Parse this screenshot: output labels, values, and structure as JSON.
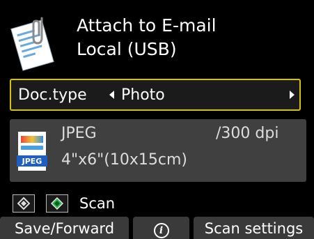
{
  "header": {
    "icon": "document-with-paperclip-icon",
    "title": "Attach to E-mail",
    "subtitle": "Local (USB)"
  },
  "doc_type": {
    "label": "Doc.type",
    "value": "Photo",
    "highlight_color": "#d9c300"
  },
  "scan_info": {
    "icon": "jpeg-file-icon",
    "icon_label": "JPEG",
    "format": "JPEG",
    "resolution": "/300 dpi",
    "paper_size": "4\"x6\"(10x15cm)"
  },
  "scan_hint": {
    "icons": [
      "black-start-key-icon",
      "color-start-key-icon"
    ],
    "label": "Scan",
    "color_key_color": "#2fb34a"
  },
  "bottom_bar": {
    "left_label": "Save/Forward",
    "center_icon": "info-icon",
    "center_glyph": "i",
    "right_label": "Scan settings"
  }
}
